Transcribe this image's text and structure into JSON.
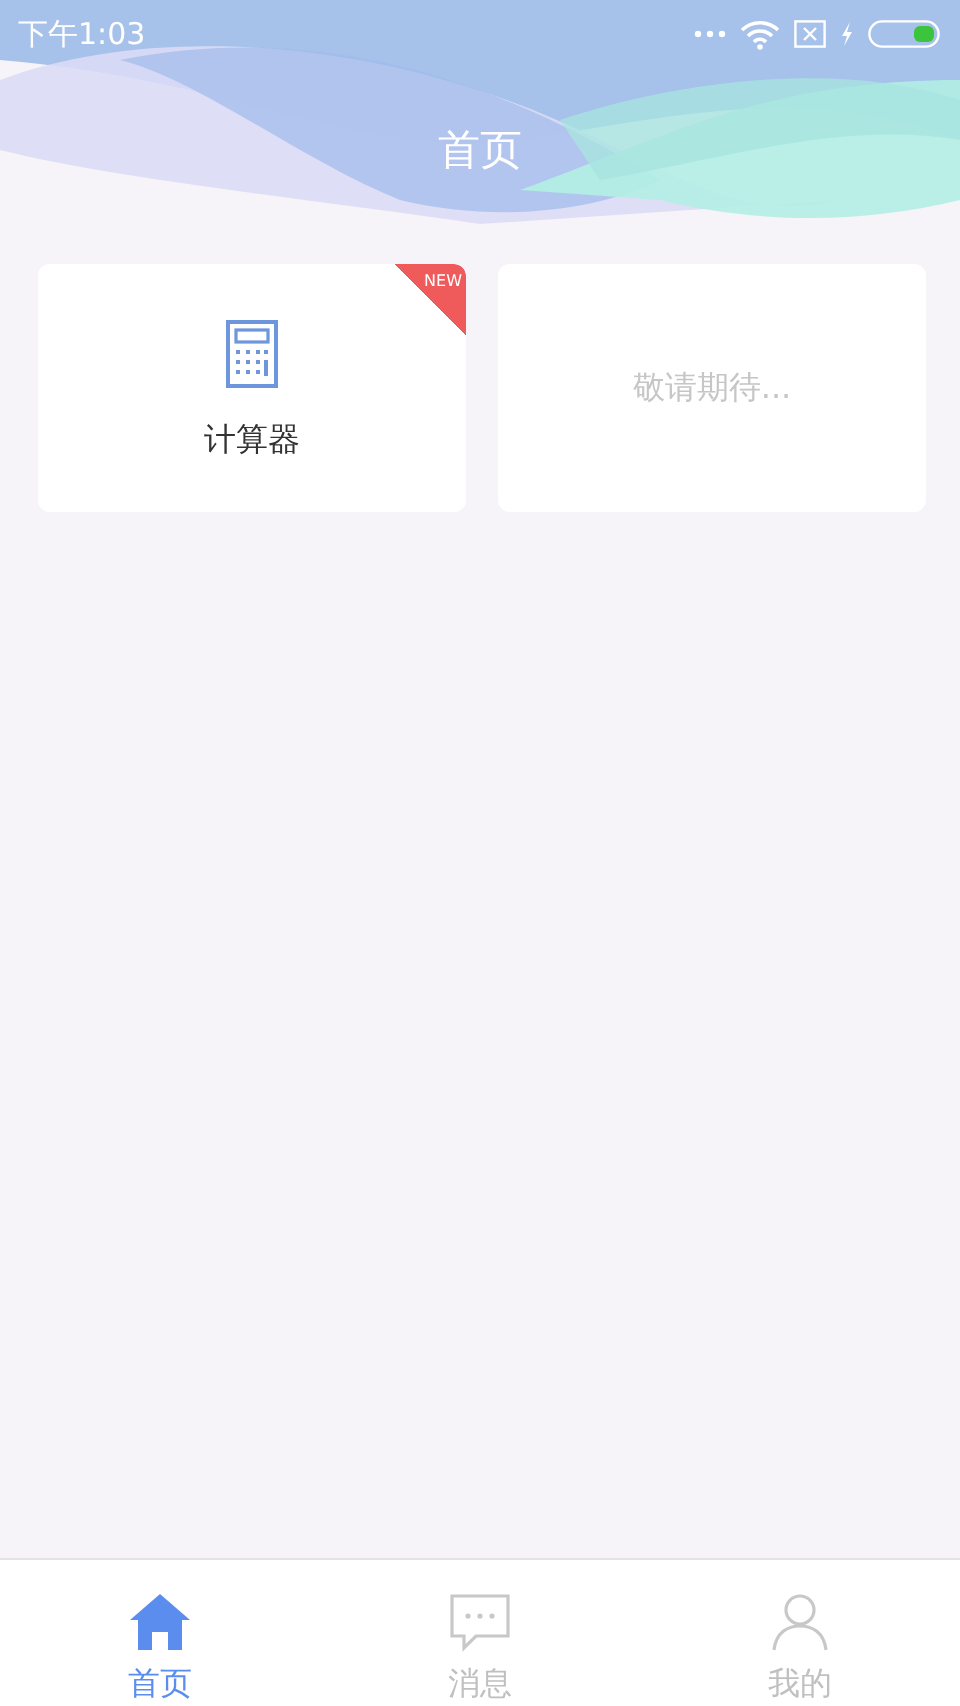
{
  "status_bar": {
    "time": "下午1:03"
  },
  "header": {
    "title": "首页"
  },
  "cards": [
    {
      "kind": "app",
      "label": "计算器",
      "badge": "NEW"
    },
    {
      "kind": "placeholder",
      "label": "敬请期待..."
    }
  ],
  "tabs": [
    {
      "kind": "home",
      "label": "首页",
      "selected": true
    },
    {
      "kind": "message",
      "label": "消息",
      "selected": false
    },
    {
      "kind": "profile",
      "label": "我的",
      "selected": false
    }
  ]
}
